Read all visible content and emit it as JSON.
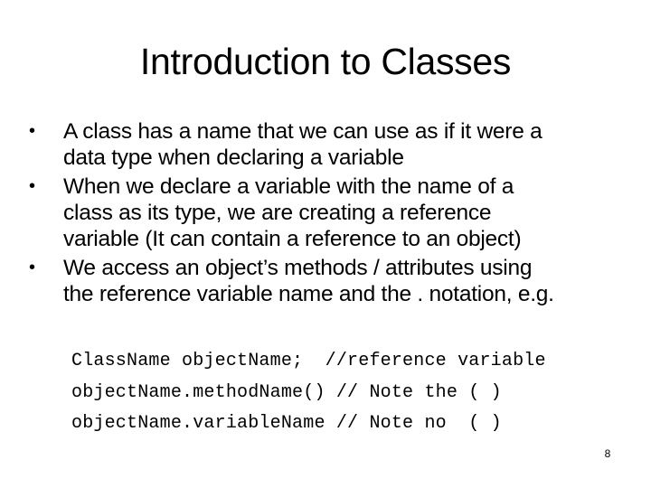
{
  "slide": {
    "title": "Introduction to Classes",
    "bullets": [
      {
        "lines": [
          "A class has a name that we can use as if it were a",
          "data type when declaring a variable"
        ]
      },
      {
        "lines": [
          "When we declare a variable with the name of a",
          "class as its type, we are creating a reference",
          "variable (It can contain a reference to an object)"
        ]
      },
      {
        "lines": [
          "We access an object’s methods / attributes using",
          "the reference variable name and the . notation, e.g."
        ]
      }
    ],
    "bullet_glyph": "•",
    "code_lines": [
      "ClassName objectName;  //reference variable",
      "objectName.methodName() // Note the ( )",
      "objectName.variableName // Note no  ( )"
    ],
    "page_number": "8"
  }
}
